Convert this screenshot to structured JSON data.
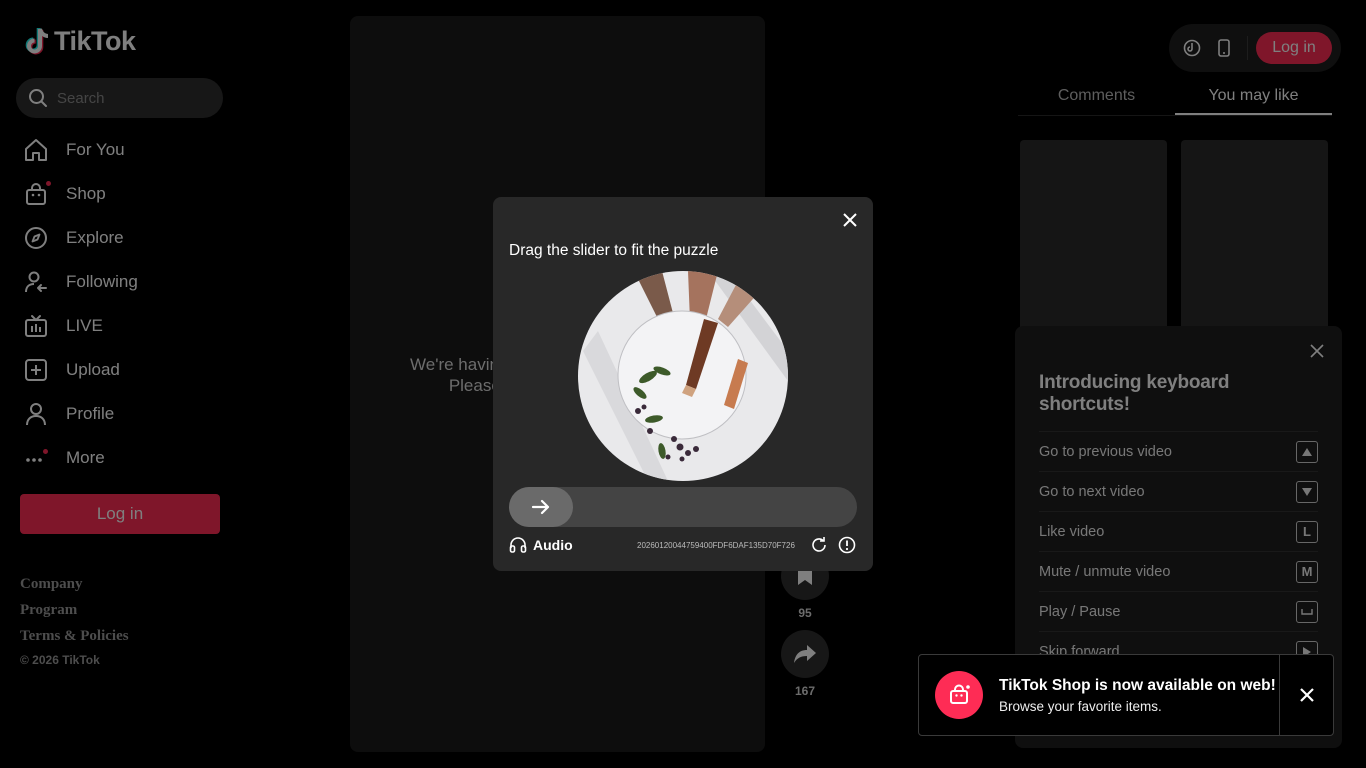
{
  "app": {
    "logo_text": "TikTok"
  },
  "search": {
    "placeholder": "Search"
  },
  "sidebar": {
    "items": [
      {
        "label": "For You",
        "icon": "home-icon"
      },
      {
        "label": "Shop",
        "icon": "shopping-bag-icon"
      },
      {
        "label": "Explore",
        "icon": "compass-icon"
      },
      {
        "label": "Following",
        "icon": "following-user-icon"
      },
      {
        "label": "LIVE",
        "icon": "live-tv-icon"
      },
      {
        "label": "Upload",
        "icon": "plus-square-icon"
      },
      {
        "label": "Profile",
        "icon": "user-icon"
      },
      {
        "label": "More",
        "icon": "more-dots-icon"
      }
    ],
    "login_label": "Log in",
    "footer": {
      "company": "Company",
      "program": "Program",
      "terms": "Terms & Policies",
      "copyright": "© 2026 TikTok"
    }
  },
  "video": {
    "message": "We're having trouble playing this video. Please refresh and try again.",
    "actions": {
      "bookmarks_count": "95",
      "shares_count": "167"
    }
  },
  "topbar": {
    "login_label": "Log in"
  },
  "right_panel": {
    "tabs": [
      {
        "label": "Comments",
        "active": false
      },
      {
        "label": "You may like",
        "active": true
      }
    ]
  },
  "shortcuts": {
    "title": "Introducing keyboard shortcuts!",
    "items": [
      {
        "label": "Go to previous video",
        "key": "up-arrow"
      },
      {
        "label": "Go to next video",
        "key": "down-arrow"
      },
      {
        "label": "Like video",
        "key": "L"
      },
      {
        "label": "Mute / unmute video",
        "key": "M"
      },
      {
        "label": "Play / Pause",
        "key": "space"
      },
      {
        "label": "Skip forward",
        "key": "right-arrow"
      }
    ]
  },
  "captcha": {
    "title": "Drag the slider to fit the puzzle",
    "audio_label": "Audio",
    "id": "20260120044759400FDF6DAF135D70F726E"
  },
  "toast": {
    "title": "TikTok Shop is now available on web!",
    "subtitle": "Browse your favorite items."
  },
  "colors": {
    "accent": "#fe2c55",
    "background": "#000000",
    "panel": "#282828"
  }
}
